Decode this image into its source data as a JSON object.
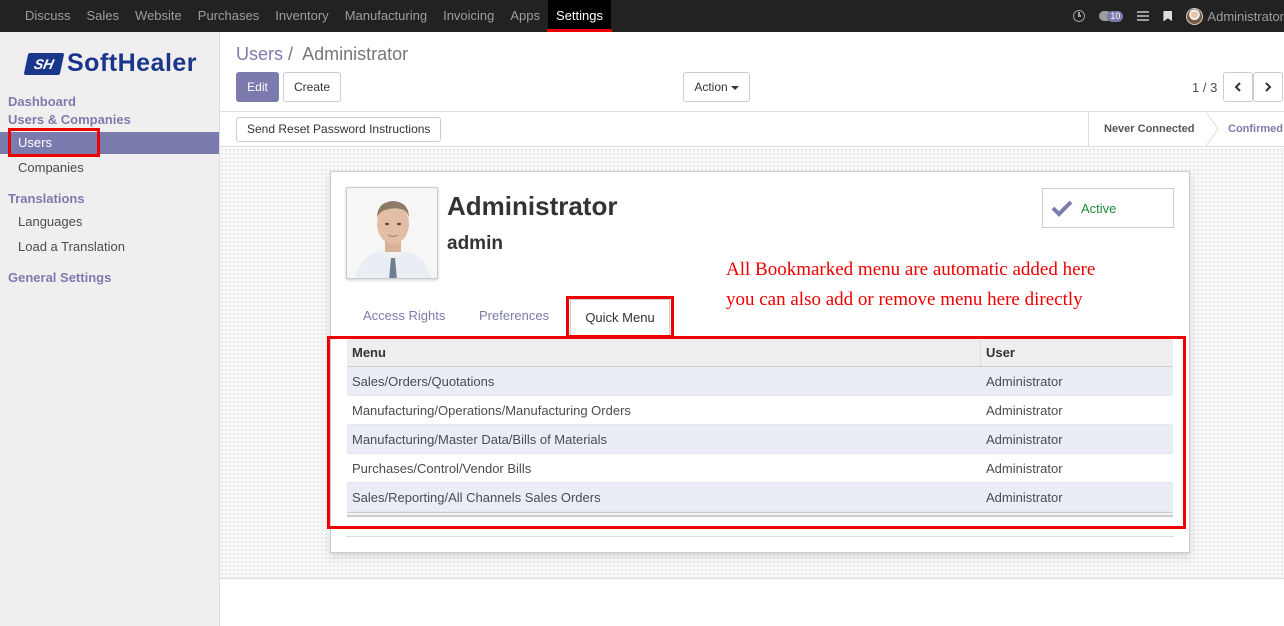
{
  "topnav": {
    "items": [
      "Discuss",
      "Sales",
      "Website",
      "Purchases",
      "Inventory",
      "Manufacturing",
      "Invoicing",
      "Apps",
      "Settings"
    ],
    "active": "Settings",
    "chat_count": "10",
    "user": "Administrator"
  },
  "logo": {
    "mark": "SH",
    "text": "SoftHealer"
  },
  "sidebar": {
    "dashboard": "Dashboard",
    "users_companies": "Users & Companies",
    "users": "Users",
    "companies": "Companies",
    "translations": "Translations",
    "languages": "Languages",
    "load_translation": "Load a Translation",
    "general_settings": "General Settings"
  },
  "breadcrumb": {
    "parent": "Users",
    "separator": "/",
    "current": "Administrator"
  },
  "buttons": {
    "edit": "Edit",
    "create": "Create",
    "action": "Action"
  },
  "pager": {
    "value": "1 / 3"
  },
  "statusbar": {
    "reset_password": "Send Reset Password Instructions",
    "stage_never": "Never Connected",
    "stage_confirmed": "Confirmed"
  },
  "form": {
    "name": "Administrator",
    "login": "admin",
    "active_label": "Active",
    "annotation_line1": "All Bookmarked menu are automatic added here",
    "annotation_line2": "you can also add or remove menu here directly",
    "tabs": [
      "Access Rights",
      "Preferences",
      "Quick Menu"
    ],
    "active_tab": "Quick Menu"
  },
  "table": {
    "headers": {
      "menu": "Menu",
      "user": "User"
    },
    "rows": [
      {
        "menu": "Sales/Orders/Quotations",
        "user": "Administrator"
      },
      {
        "menu": "Manufacturing/Operations/Manufacturing Orders",
        "user": "Administrator"
      },
      {
        "menu": "Manufacturing/Master Data/Bills of Materials",
        "user": "Administrator"
      },
      {
        "menu": "Purchases/Control/Vendor Bills",
        "user": "Administrator"
      },
      {
        "menu": "Sales/Reporting/All Channels Sales Orders",
        "user": "Administrator"
      }
    ]
  },
  "colors": {
    "accent": "#7c7bad",
    "highlight": "#e00000",
    "topbar": "#222222"
  }
}
